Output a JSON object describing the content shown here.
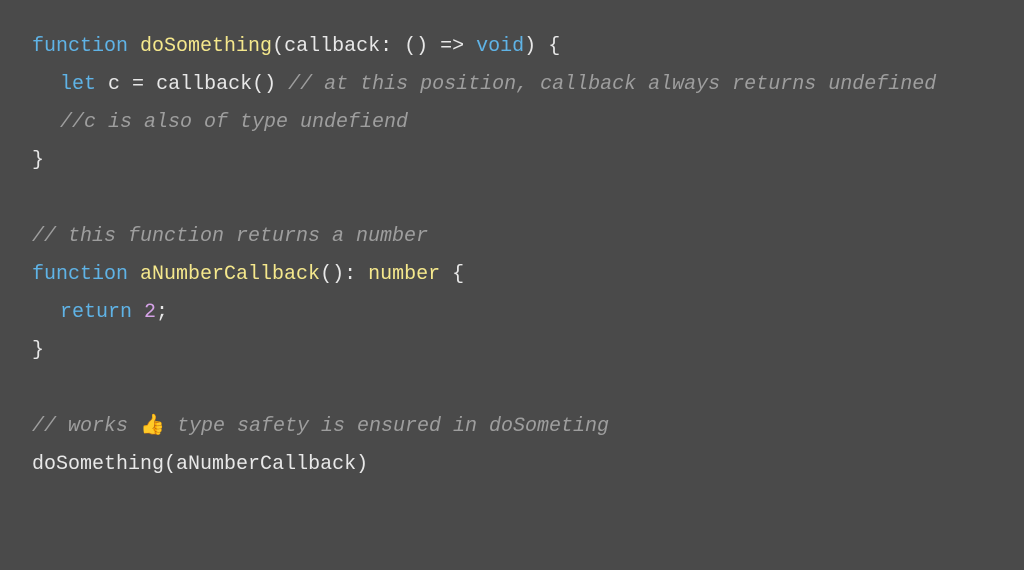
{
  "code": {
    "line1": {
      "kw_function": "function",
      "fn_name": "doSomething",
      "open_paren": "(",
      "param": "callback",
      "colon": ": ",
      "arrow_open": "() ",
      "arrow": "=>",
      "space": " ",
      "void": "void",
      "close_paren": ")",
      "brace": " {"
    },
    "line2": {
      "kw_let": "let",
      "space1": " ",
      "var": "c",
      "eq": " = ",
      "call": "callback()",
      "space2": " ",
      "comment": "// at this position, callback always returns undefined"
    },
    "line3": {
      "comment": "//c is also of type undefiend"
    },
    "line4": {
      "brace": "}"
    },
    "line6": {
      "comment": "// this function returns a number"
    },
    "line7": {
      "kw_function": "function",
      "space": " ",
      "fn_name": "aNumberCallback",
      "parens": "()",
      "colon": ": ",
      "type": "number",
      "brace": " {"
    },
    "line8": {
      "kw_return": "return",
      "space": " ",
      "num": "2",
      "semi": ";"
    },
    "line9": {
      "brace": "}"
    },
    "line11": {
      "comment_pre": "// works ",
      "emoji": "👍",
      "comment_post": " type safety is ensured in doSometing"
    },
    "line12": {
      "call_fn": "doSomething",
      "open": "(",
      "arg": "aNumberCallback",
      "close": ")"
    }
  }
}
